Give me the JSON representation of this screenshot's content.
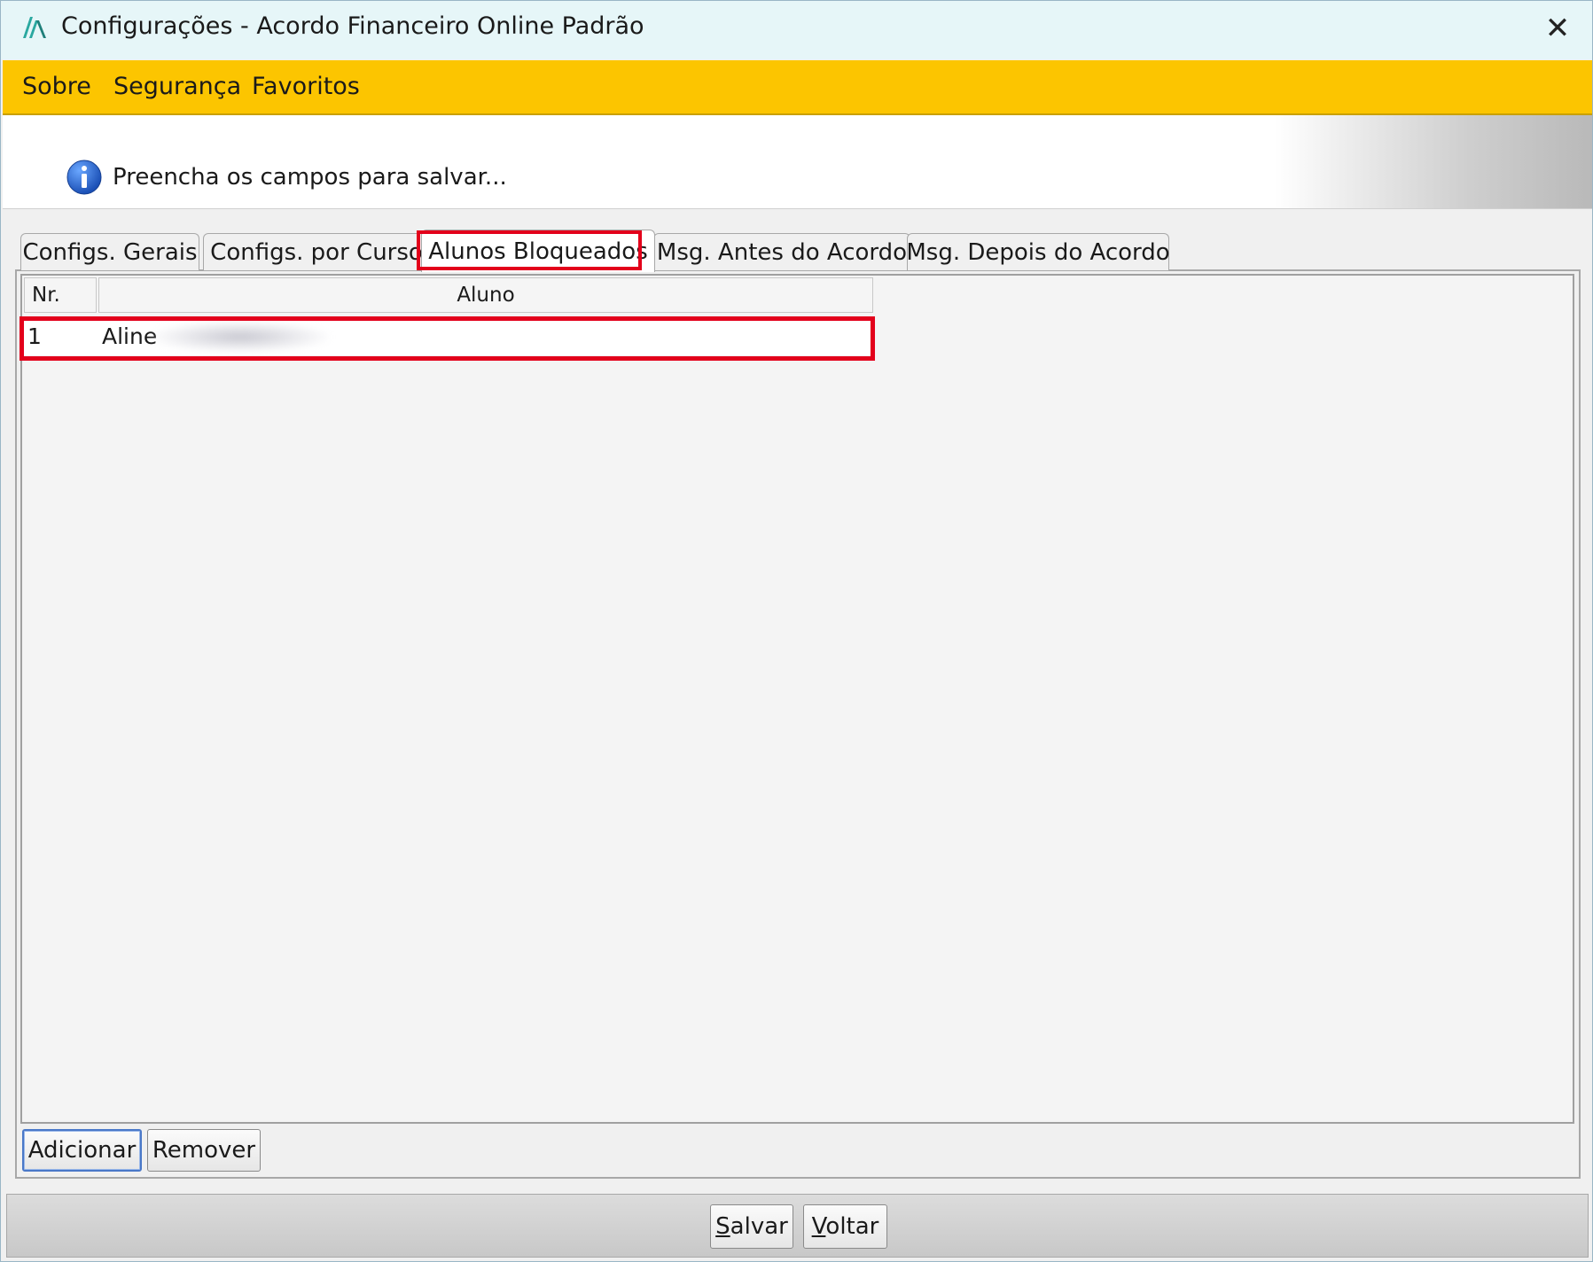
{
  "window": {
    "title": "Configurações - Acordo Financeiro Online Padrão",
    "close_symbol": "✕",
    "app_icon": "app-logo-icon"
  },
  "menu": {
    "items": [
      "Sobre",
      "Segurança",
      "Favoritos"
    ]
  },
  "info": {
    "message": "Preencha os campos para salvar...",
    "icon": "info-icon"
  },
  "tabs": {
    "items": [
      "Configs. Gerais",
      "Configs. por Curso",
      "Alunos Bloqueados",
      "Msg. Antes do Acordo",
      "Msg. Depois do Acordo"
    ],
    "active": "Alunos Bloqueados"
  },
  "table": {
    "columns": [
      "Nr.",
      "Aluno"
    ],
    "rows": [
      {
        "nr": "1",
        "aluno": "Aline"
      }
    ]
  },
  "panel_buttons": {
    "add": "Adicionar",
    "remove": "Remover"
  },
  "footer_buttons": {
    "save": "Salvar",
    "back": "Voltar"
  },
  "colors": {
    "menubar": "#fcc500",
    "titlebar": "#e6f6f8",
    "highlight": "#e3001b",
    "logo": "#2aa8a0"
  }
}
